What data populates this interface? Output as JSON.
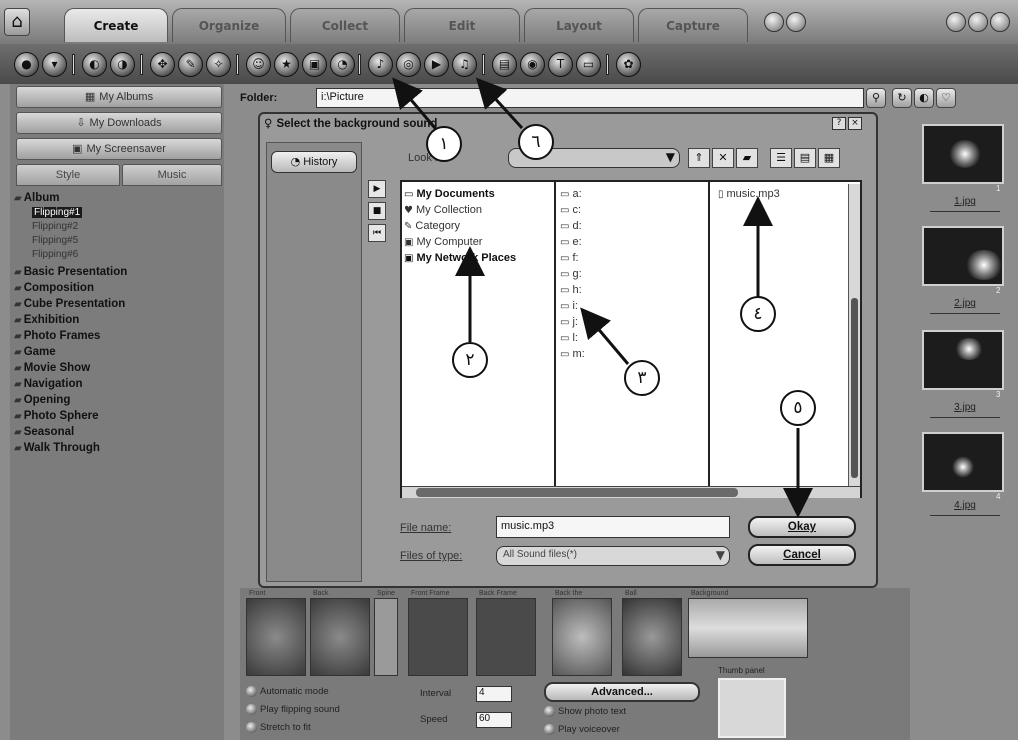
{
  "tabs": [
    "Create",
    "Organize",
    "Collect",
    "Edit",
    "Layout",
    "Capture"
  ],
  "left_panel": {
    "nav_buttons": [
      "My Albums",
      "My Downloads",
      "My Screensaver"
    ],
    "subtabs": [
      "Style",
      "Music"
    ],
    "tree": {
      "root": "Album",
      "leaves": [
        "Flipping#1",
        "Flipping#2",
        "Flipping#5",
        "Flipping#6"
      ],
      "categories": [
        "Basic Presentation",
        "Composition",
        "Cube Presentation",
        "Exhibition",
        "Photo Frames",
        "Game",
        "Movie Show",
        "Navigation",
        "Opening",
        "Photo Sphere",
        "Seasonal",
        "Walk Through"
      ]
    }
  },
  "folder": {
    "label": "Folder:",
    "value": "i:\\Picture"
  },
  "thumbnails": [
    {
      "label": "1.jpg",
      "num": "1"
    },
    {
      "label": "2.jpg",
      "num": "2"
    },
    {
      "label": "3.jpg",
      "num": "3"
    },
    {
      "label": "4.jpg",
      "num": "4"
    }
  ],
  "dialog": {
    "title": "Select the background sound",
    "history_label": "History",
    "look_in_label": "Look in:",
    "places": [
      "My Documents",
      "My Collection",
      "Category",
      "My Computer",
      "My Network Places"
    ],
    "drives": [
      "a:",
      "c:",
      "d:",
      "e:",
      "f:",
      "g:",
      "h:",
      "i:",
      "j:",
      "l:",
      "m:"
    ],
    "files": [
      "music.mp3"
    ],
    "file_name_label": "File name:",
    "file_name_value": "music.mp3",
    "files_of_type_label": "Files of type:",
    "files_of_type_value": "All Sound files(*)",
    "ok_label": "Okay",
    "cancel_label": "Cancel"
  },
  "bottom": {
    "tile_labels": [
      "Front",
      "Back",
      "Spine",
      "Front Frame",
      "Back Frame",
      "Back the",
      "Ball",
      "Background"
    ],
    "options_left": [
      "Automatic mode",
      "Play flipping sound",
      "Stretch to fit"
    ],
    "interval_label": "Interval",
    "interval_value": "4",
    "speed_label": "Speed",
    "speed_value": "60",
    "advanced_label": "Advanced...",
    "options_right": [
      "Show photo text",
      "Play voiceover"
    ],
    "thumb_panel_label": "Thumb panel"
  },
  "callouts": [
    "١",
    "٢",
    "٣",
    "٤",
    "٥",
    "٦"
  ]
}
